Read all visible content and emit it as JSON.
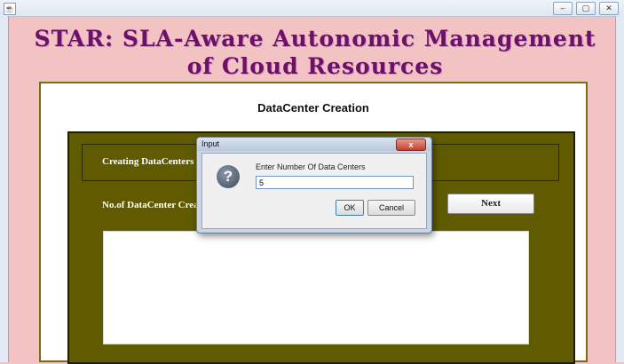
{
  "window": {
    "app_icon": "java-icon",
    "controls": [
      "minimize-icon",
      "restore-icon",
      "close-icon"
    ]
  },
  "app": {
    "title_line1": "STAR: SLA-Aware Autonomic Management",
    "title_line2": "of Cloud Resources"
  },
  "panel": {
    "title": "DataCenter Creation",
    "group_label": "Creating DataCenters",
    "count_label": "No.of DataCenter Crea",
    "next_label": "Next",
    "output_text": ""
  },
  "dialog": {
    "title": "Input",
    "close_label": "x",
    "icon": "question-icon",
    "message": "Enter Number Of Data Centers",
    "input_value": "5",
    "ok_label": "OK",
    "cancel_label": "Cancel"
  },
  "colors": {
    "background": "#f3c3c3",
    "title_color": "#6e0f68",
    "olive_panel": "#605b00",
    "dialog_close": "#c7402a"
  }
}
